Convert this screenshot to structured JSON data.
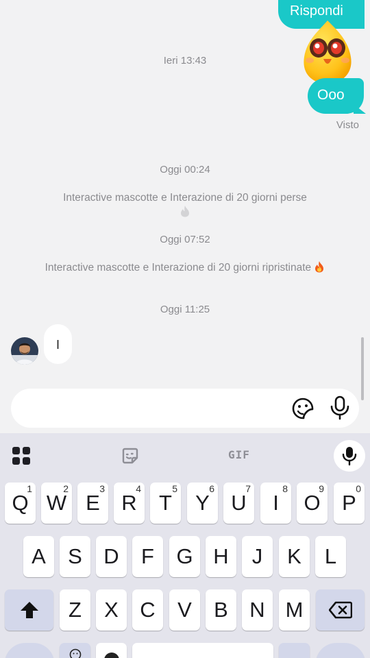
{
  "chat": {
    "reply_label": "Rispondi",
    "ooo_message": "Ooo",
    "seen_label": "Visto",
    "timestamp_1": "Ieri 13:43",
    "timestamp_2": "Oggi 00:24",
    "system_1": "Interactive mascotte e Interazione di 20 giorni perse",
    "timestamp_3": "Oggi 07:52",
    "system_2": "Interactive mascotte e Interazione di 20 giorni ripristinate",
    "timestamp_4": "Oggi 11:25",
    "incoming_message": "I",
    "mascot_icon": "mascot-sticker",
    "fire_icon": "fire-icon",
    "accent_color": "#1ac8c8"
  },
  "composer": {
    "input_value": "",
    "sticker_icon": "sticker-icon",
    "mic_icon": "microphone-icon"
  },
  "keyboard": {
    "gif_label": "GIF",
    "row1": [
      {
        "label": "Q",
        "sup": "1"
      },
      {
        "label": "W",
        "sup": "2"
      },
      {
        "label": "E",
        "sup": "3"
      },
      {
        "label": "R",
        "sup": "4"
      },
      {
        "label": "T",
        "sup": "5"
      },
      {
        "label": "Y",
        "sup": "6"
      },
      {
        "label": "U",
        "sup": "7"
      },
      {
        "label": "I",
        "sup": "8"
      },
      {
        "label": "O",
        "sup": "9"
      },
      {
        "label": "P",
        "sup": "0"
      }
    ],
    "row2": [
      "A",
      "S",
      "D",
      "F",
      "G",
      "H",
      "J",
      "K",
      "L"
    ],
    "row3": [
      "Z",
      "X",
      "C",
      "V",
      "B",
      "N",
      "M"
    ]
  }
}
